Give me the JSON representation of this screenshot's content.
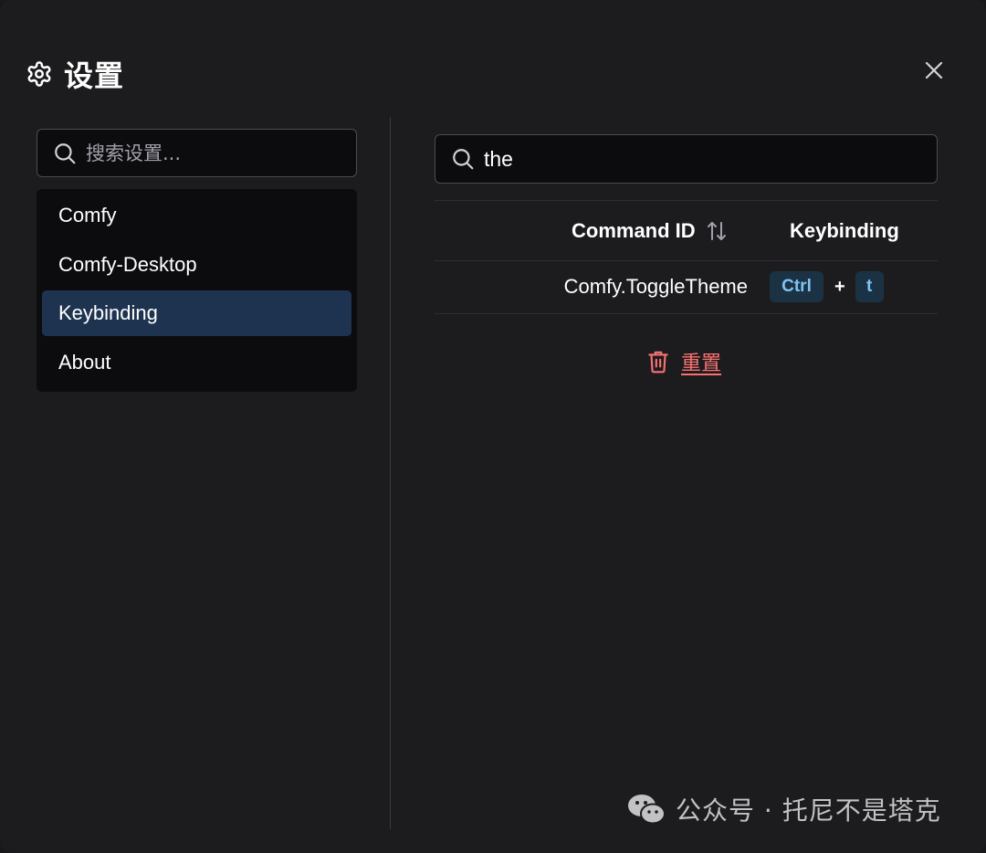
{
  "header": {
    "icon": "gear-icon",
    "title": "设置",
    "close_icon": "close-icon"
  },
  "sidebar": {
    "search": {
      "placeholder": "搜索设置...",
      "value": ""
    },
    "items": [
      {
        "label": "Comfy",
        "active": false
      },
      {
        "label": "Comfy-Desktop",
        "active": false
      },
      {
        "label": "Keybinding",
        "active": true
      },
      {
        "label": "About",
        "active": false
      }
    ]
  },
  "main": {
    "search": {
      "value": "the",
      "placeholder": ""
    },
    "table": {
      "headers": {
        "command_id": "Command ID",
        "keybinding": "Keybinding"
      },
      "rows": [
        {
          "command_id": "Comfy.ToggleTheme",
          "keys": [
            "Ctrl",
            "t"
          ],
          "separator": "+"
        }
      ]
    },
    "reset_button": {
      "label": "重置",
      "icon": "trash-icon"
    }
  },
  "watermark": {
    "icon": "wechat-icon",
    "text": "公众号 · 托尼不是塔克"
  },
  "colors": {
    "background": "#1c1c1f",
    "active_item": "#1e3350",
    "kbd_bg": "#1b3244",
    "kbd_text": "#7dc4f2",
    "reset": "#f87171"
  }
}
